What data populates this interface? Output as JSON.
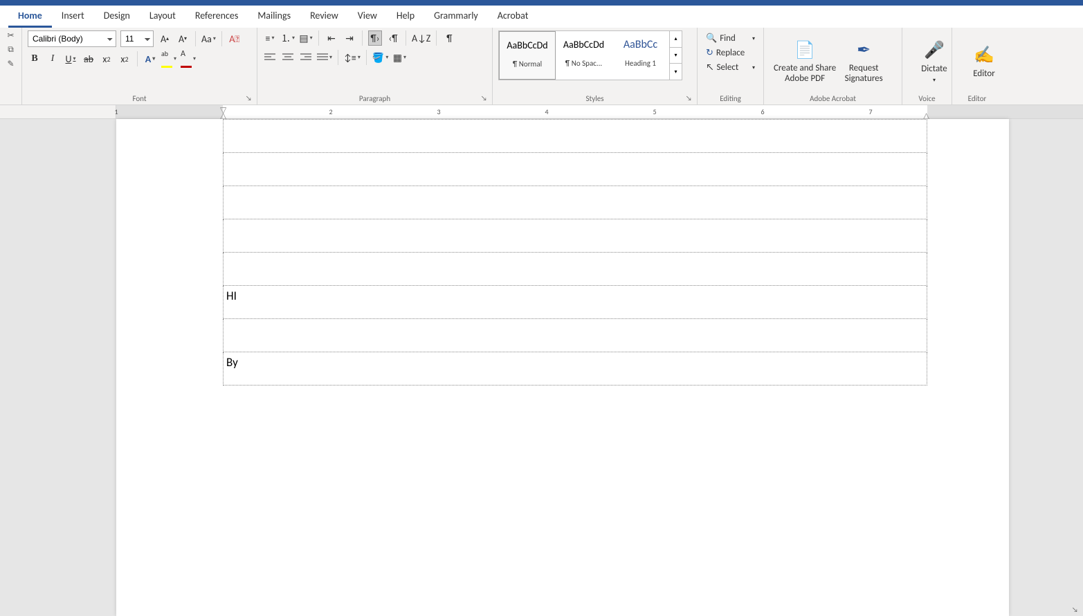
{
  "tabs": {
    "items": [
      "Home",
      "Insert",
      "Design",
      "Layout",
      "References",
      "Mailings",
      "Review",
      "View",
      "Help",
      "Grammarly",
      "Acrobat"
    ],
    "active": 0
  },
  "font": {
    "name": "Calibri (Body)",
    "size": "11",
    "group_label": "Font"
  },
  "paragraph": {
    "group_label": "Paragraph"
  },
  "styles": {
    "group_label": "Styles",
    "items": [
      {
        "preview": "AaBbCcDd",
        "name": "¶ Normal",
        "heading": false,
        "selected": true
      },
      {
        "preview": "AaBbCcDd",
        "name": "¶ No Spac...",
        "heading": false,
        "selected": false
      },
      {
        "preview": "AaBbCc",
        "name": "Heading 1",
        "heading": true,
        "selected": false
      }
    ]
  },
  "editing": {
    "group_label": "Editing",
    "find": "Find",
    "replace": "Replace",
    "select": "Select"
  },
  "acrobat": {
    "group_label": "Adobe Acrobat",
    "create": "Create and Share",
    "create2": "Adobe PDF",
    "request": "Request",
    "request2": "Signatures"
  },
  "voice": {
    "group_label": "Voice",
    "dictate": "Dictate"
  },
  "editor": {
    "group_label": "Editor",
    "label": "Editor"
  },
  "ruler": {
    "numbers": [
      "1",
      "2",
      "3",
      "4",
      "5",
      "6",
      "7"
    ]
  },
  "document": {
    "rows": [
      {
        "text": ""
      },
      {
        "text": ""
      },
      {
        "text": ""
      },
      {
        "text": ""
      },
      {
        "text": ""
      },
      {
        "text": "HI"
      },
      {
        "text": ""
      },
      {
        "text": "By"
      }
    ]
  }
}
